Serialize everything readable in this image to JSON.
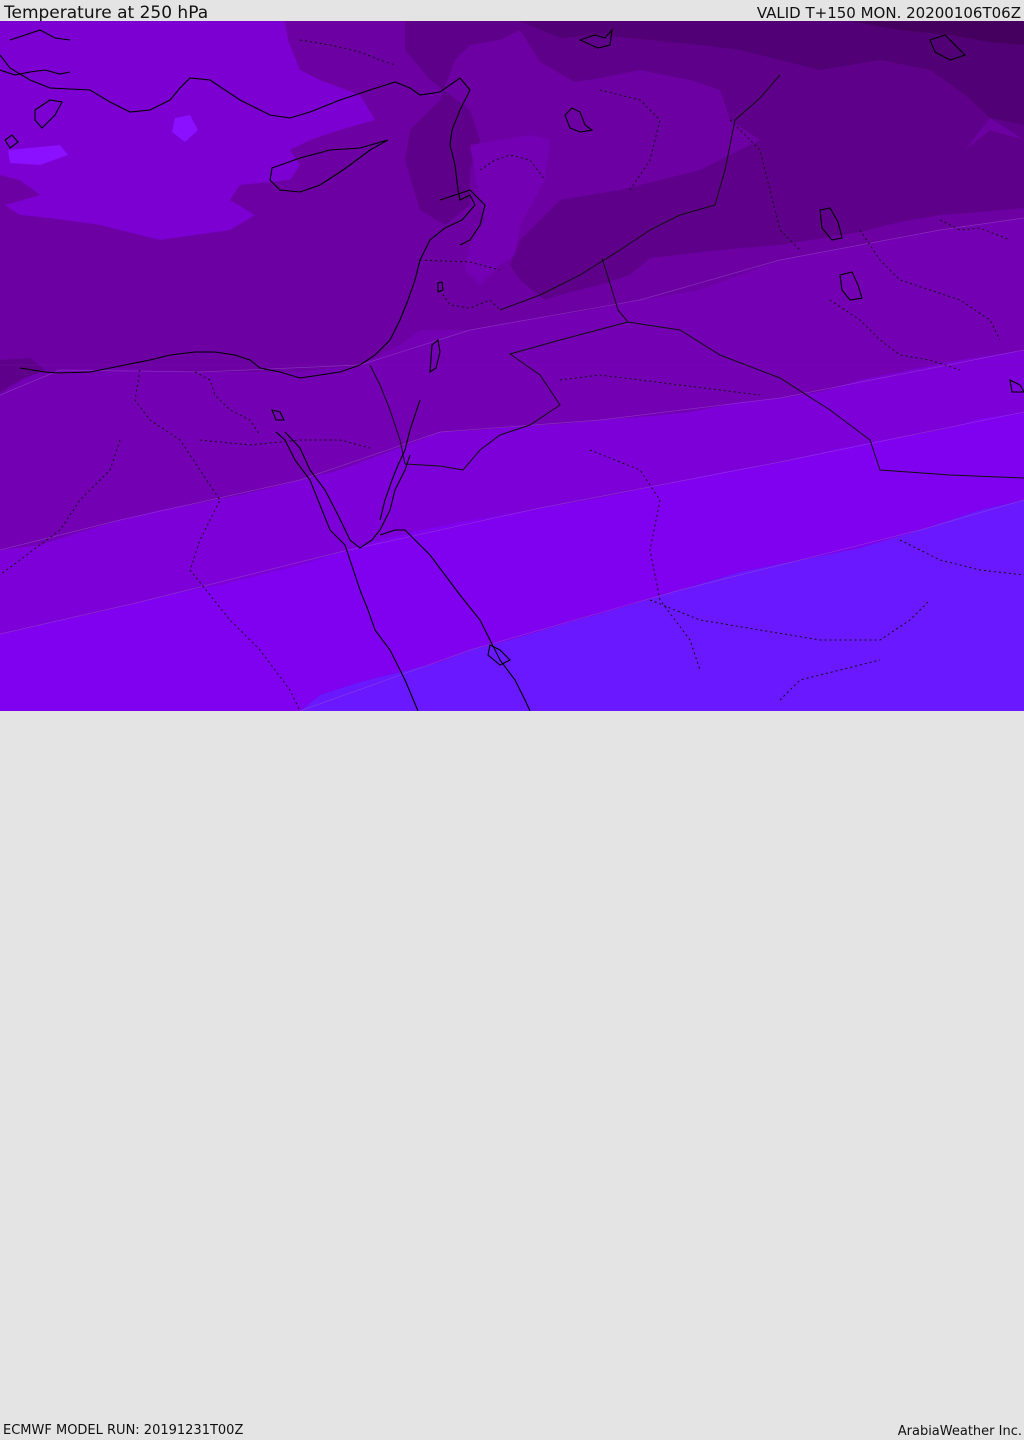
{
  "header": {
    "title": "Temperature at 250 hPa",
    "valid": "VALID T+150 MON. 20200106T06Z"
  },
  "footer": {
    "model_run": "ECMWF MODEL RUN: 20191231T00Z",
    "credit": "ArabiaWeather Inc."
  },
  "map": {
    "field": "temperature-250hPa",
    "palette": [
      "#520076",
      "#5f008a",
      "#6c00a3",
      "#7300b3",
      "#7c00d7",
      "#8000f0",
      "#7c00ff",
      "#6a18ff"
    ],
    "coastline_color": "#000000",
    "border_style": "dotted"
  }
}
